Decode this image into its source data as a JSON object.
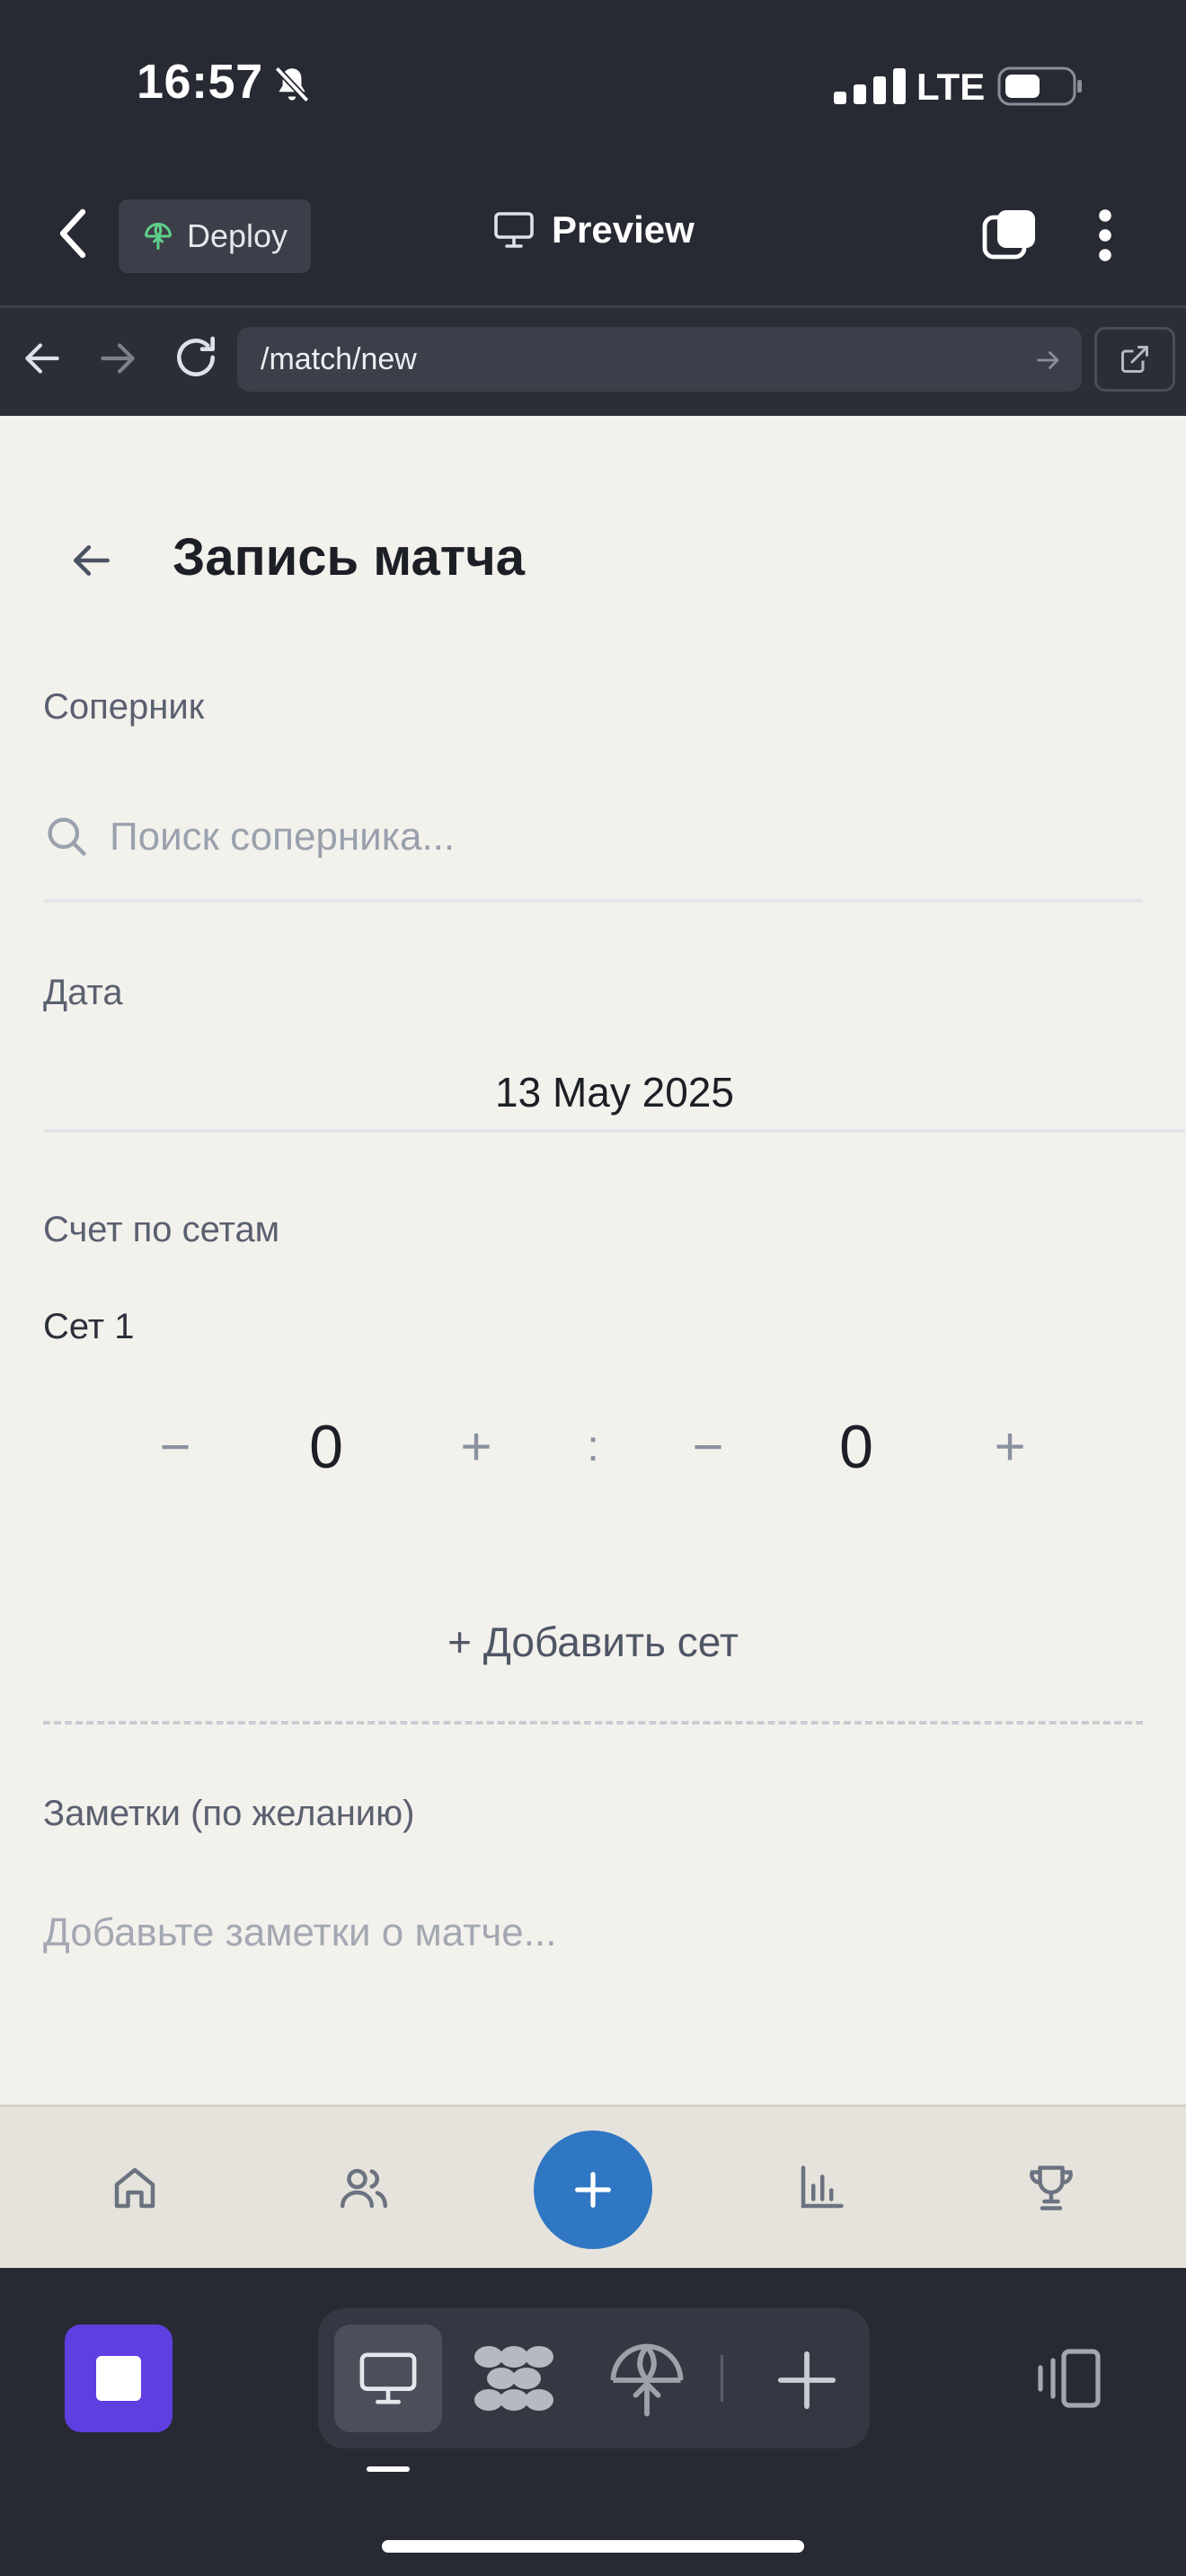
{
  "status_bar": {
    "time": "16:57",
    "network": "LTE"
  },
  "header": {
    "deploy_label": "Deploy",
    "preview_label": "Preview"
  },
  "browser": {
    "url": "/match/new"
  },
  "page": {
    "title": "Запись матча",
    "opponent_label": "Соперник",
    "opponent_placeholder": "Поиск соперника...",
    "date_label": "Дата",
    "date_value": "13 May 2025",
    "score_label": "Счет по сетам",
    "sets": [
      {
        "label": "Сет 1",
        "player_score": "0",
        "opponent_score": "0"
      }
    ],
    "stepper": {
      "minus": "−",
      "plus": "+",
      "separator": ":"
    },
    "add_set_label": "+ Добавить сет",
    "notes_label": "Заметки (по желанию)",
    "notes_placeholder": "Добавьте заметки о матче..."
  },
  "app_nav": {
    "items": [
      {
        "icon": "home-icon"
      },
      {
        "icon": "people-icon"
      },
      {
        "icon": "plus-icon",
        "accent": "#2f76c3"
      },
      {
        "icon": "bar-chart-icon"
      },
      {
        "icon": "trophy-icon"
      }
    ]
  },
  "toolbar": {
    "stop_color": "#5f3fe0",
    "items": [
      {
        "icon": "monitor-icon",
        "active": true
      },
      {
        "icon": "agent-icon"
      },
      {
        "icon": "deploy-icon"
      },
      {
        "icon": "plus-icon"
      }
    ]
  },
  "colors": {
    "background": "#272a33",
    "page": "#f3f1ec",
    "accent": "#2f76c3"
  }
}
